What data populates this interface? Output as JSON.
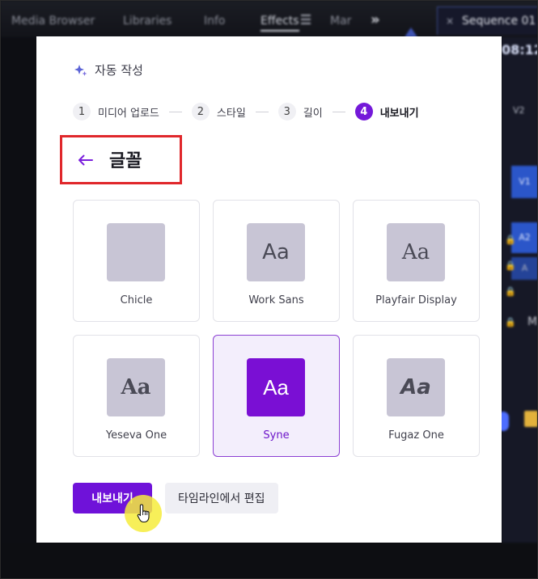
{
  "background": {
    "tabs": [
      "Media Browser",
      "Libraries",
      "Info",
      "Effects",
      "Mar"
    ],
    "active_tab": "Effects",
    "sequence_tab": "Sequence 01",
    "sequence_close": "×",
    "timecode": "08:12",
    "overflow_chevron": "»",
    "tracks": [
      "V2",
      "V1",
      "A2",
      "A",
      "M"
    ]
  },
  "panel": {
    "header_title": "자동 작성",
    "steps": [
      {
        "num": "1",
        "label": "미디어 업로드",
        "active": false
      },
      {
        "num": "2",
        "label": "스타일",
        "active": false
      },
      {
        "num": "3",
        "label": "길이",
        "active": false
      },
      {
        "num": "4",
        "label": "내보내기",
        "active": true
      }
    ],
    "section_title": "글꼴",
    "fonts": [
      {
        "name": "Chicle",
        "sample": "",
        "selected": false
      },
      {
        "name": "Work Sans",
        "sample": "Aa",
        "selected": false
      },
      {
        "name": "Playfair Display",
        "sample": "Aa",
        "selected": false
      },
      {
        "name": "Yeseva One",
        "sample": "Aa",
        "selected": false
      },
      {
        "name": "Syne",
        "sample": "Aa",
        "selected": true
      },
      {
        "name": "Fugaz One",
        "sample": "Aa",
        "selected": false
      }
    ],
    "primary_button": "내보내기",
    "secondary_button": "타임라인에서 편집"
  },
  "colors": {
    "accent": "#7419d9",
    "highlight_box": "#e0272b",
    "swatch": "#c8c5d5",
    "selected_card_bg": "#f3eefc"
  }
}
